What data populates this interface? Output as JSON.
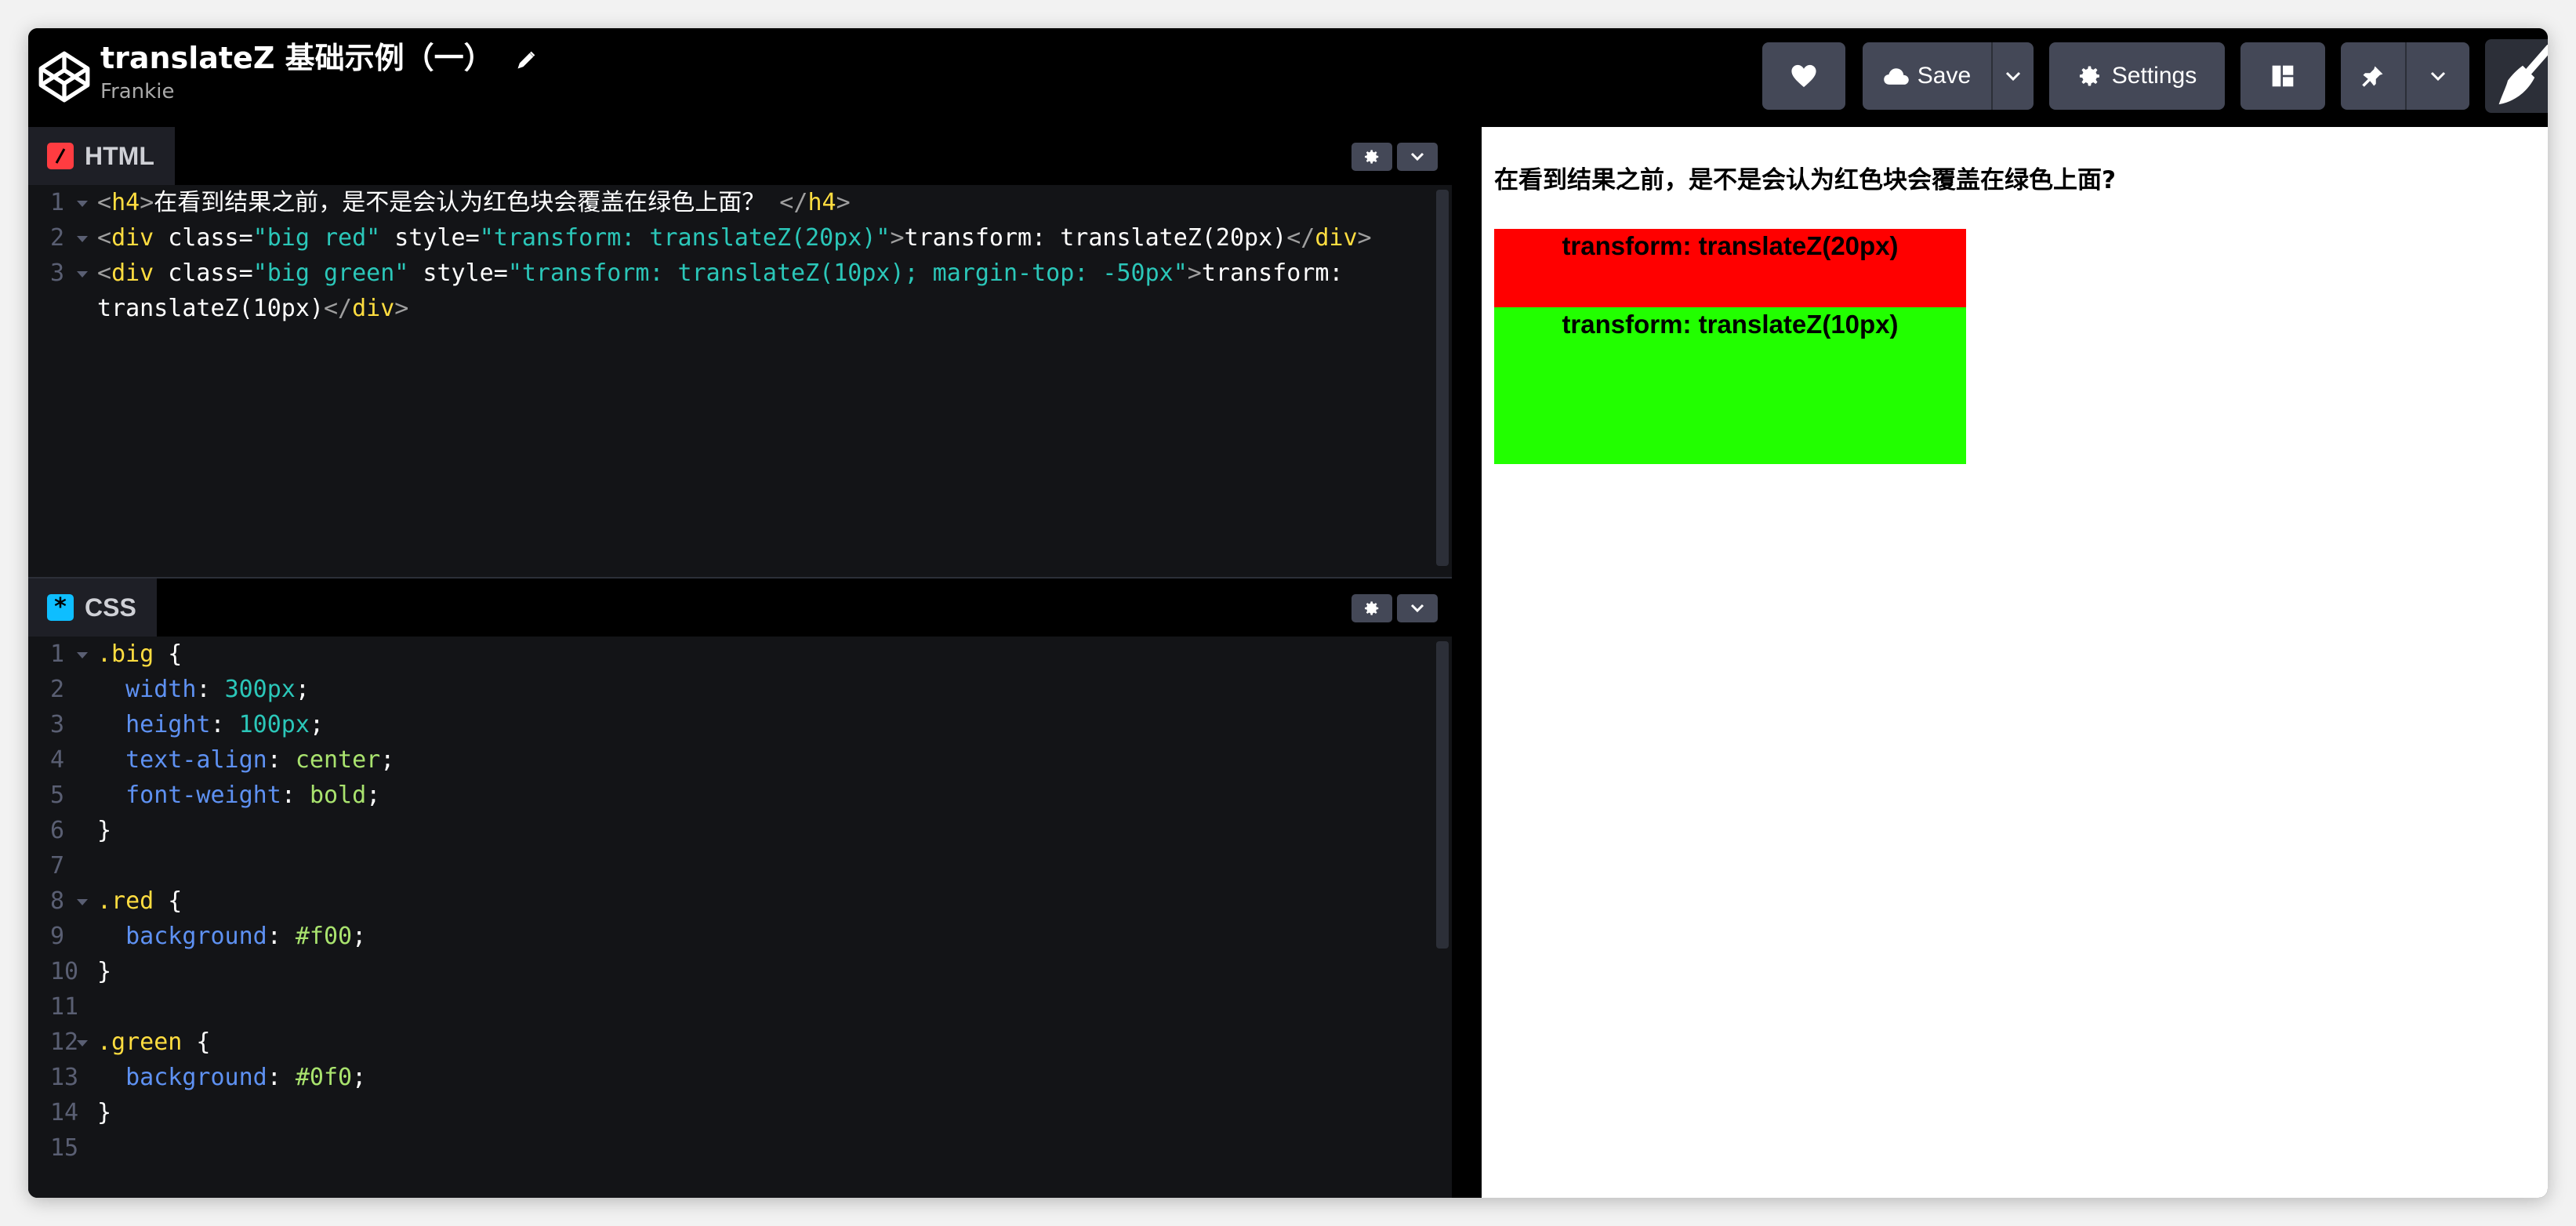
{
  "header": {
    "title": "translateZ 基础示例（一）",
    "author": "Frankie",
    "save_label": "Save",
    "settings_label": "Settings"
  },
  "html_pane": {
    "tab_label": "HTML",
    "lines": [
      {
        "num": "1",
        "parts": [
          [
            "c-br",
            "<"
          ],
          [
            "c-tag",
            "h4"
          ],
          [
            "c-br",
            ">"
          ],
          [
            "c-attr",
            "在看到结果之前，是不是会认为红色块会覆盖在绿色上面？"
          ],
          [
            "c-br",
            " </"
          ],
          [
            "c-tag",
            "h4"
          ],
          [
            "c-br",
            ">"
          ]
        ]
      },
      {
        "num": "2",
        "parts": [
          [
            "c-br",
            "<"
          ],
          [
            "c-tag",
            "div"
          ],
          [
            "c-attr",
            " class="
          ],
          [
            "c-str",
            "\"big red\""
          ],
          [
            "c-attr",
            " style="
          ],
          [
            "c-str",
            "\"transform: translateZ(20px)\""
          ],
          [
            "c-br",
            ">"
          ],
          [
            "c-attr",
            "transform: translateZ(20px)"
          ],
          [
            "c-br",
            "</"
          ],
          [
            "c-tag",
            "div"
          ],
          [
            "c-br",
            ">"
          ]
        ]
      },
      {
        "num": "3",
        "parts": [
          [
            "c-br",
            "<"
          ],
          [
            "c-tag",
            "div"
          ],
          [
            "c-attr",
            " class="
          ],
          [
            "c-str",
            "\"big green\""
          ],
          [
            "c-attr",
            " style="
          ],
          [
            "c-str",
            "\"transform: translateZ(10px); margin-top: -50px\""
          ],
          [
            "c-br",
            ">"
          ],
          [
            "c-attr",
            "transform:"
          ]
        ],
        "cont": [
          [
            "c-attr",
            "translateZ(10px)"
          ],
          [
            "c-br",
            "</"
          ],
          [
            "c-tag",
            "div"
          ],
          [
            "c-br",
            ">"
          ]
        ]
      }
    ]
  },
  "css_pane": {
    "tab_label": "CSS",
    "lines": [
      {
        "num": "1",
        "fold": true,
        "parts": [
          [
            "c-sel",
            ".big"
          ],
          [
            "c-attr",
            " {"
          ]
        ]
      },
      {
        "num": "2",
        "parts": [
          [
            "c-attr",
            "  "
          ],
          [
            "c-prop",
            "width"
          ],
          [
            "c-attr",
            ": "
          ],
          [
            "c-num",
            "300px"
          ],
          [
            "c-attr",
            ";"
          ]
        ]
      },
      {
        "num": "3",
        "parts": [
          [
            "c-attr",
            "  "
          ],
          [
            "c-prop",
            "height"
          ],
          [
            "c-attr",
            ": "
          ],
          [
            "c-num",
            "100px"
          ],
          [
            "c-attr",
            ";"
          ]
        ]
      },
      {
        "num": "4",
        "parts": [
          [
            "c-attr",
            "  "
          ],
          [
            "c-prop",
            "text-align"
          ],
          [
            "c-attr",
            ": "
          ],
          [
            "c-val",
            "center"
          ],
          [
            "c-attr",
            ";"
          ]
        ]
      },
      {
        "num": "5",
        "parts": [
          [
            "c-attr",
            "  "
          ],
          [
            "c-prop",
            "font-weight"
          ],
          [
            "c-attr",
            ": "
          ],
          [
            "c-val",
            "bold"
          ],
          [
            "c-attr",
            ";"
          ]
        ]
      },
      {
        "num": "6",
        "parts": [
          [
            "c-attr",
            "}"
          ]
        ]
      },
      {
        "num": "7",
        "parts": []
      },
      {
        "num": "8",
        "fold": true,
        "parts": [
          [
            "c-sel",
            ".red"
          ],
          [
            "c-attr",
            " {"
          ]
        ]
      },
      {
        "num": "9",
        "parts": [
          [
            "c-attr",
            "  "
          ],
          [
            "c-prop",
            "background"
          ],
          [
            "c-attr",
            ": "
          ],
          [
            "c-val",
            "#f00"
          ],
          [
            "c-attr",
            ";"
          ]
        ]
      },
      {
        "num": "10",
        "parts": [
          [
            "c-attr",
            "}"
          ]
        ]
      },
      {
        "num": "11",
        "parts": []
      },
      {
        "num": "12",
        "fold": true,
        "parts": [
          [
            "c-sel",
            ".green"
          ],
          [
            "c-attr",
            " {"
          ]
        ]
      },
      {
        "num": "13",
        "parts": [
          [
            "c-attr",
            "  "
          ],
          [
            "c-prop",
            "background"
          ],
          [
            "c-attr",
            ": "
          ],
          [
            "c-val",
            "#0f0"
          ],
          [
            "c-attr",
            ";"
          ]
        ]
      },
      {
        "num": "14",
        "parts": [
          [
            "c-attr",
            "}"
          ]
        ]
      },
      {
        "num": "15",
        "parts": []
      }
    ]
  },
  "preview": {
    "heading": "在看到结果之前，是不是会认为红色块会覆盖在绿色上面?",
    "red_box_text": "transform: translateZ(20px)",
    "green_box_text": "transform: translateZ(10px)"
  },
  "colors": {
    "accent_red": "#ff0000",
    "accent_green": "#22ff00",
    "button_bg": "#444857"
  },
  "icons": [
    "codepen-logo-icon",
    "pencil-icon",
    "heart-icon",
    "cloud-icon",
    "chevron-down-icon",
    "gear-icon",
    "layout-icon",
    "pin-icon",
    "broom-icon"
  ]
}
